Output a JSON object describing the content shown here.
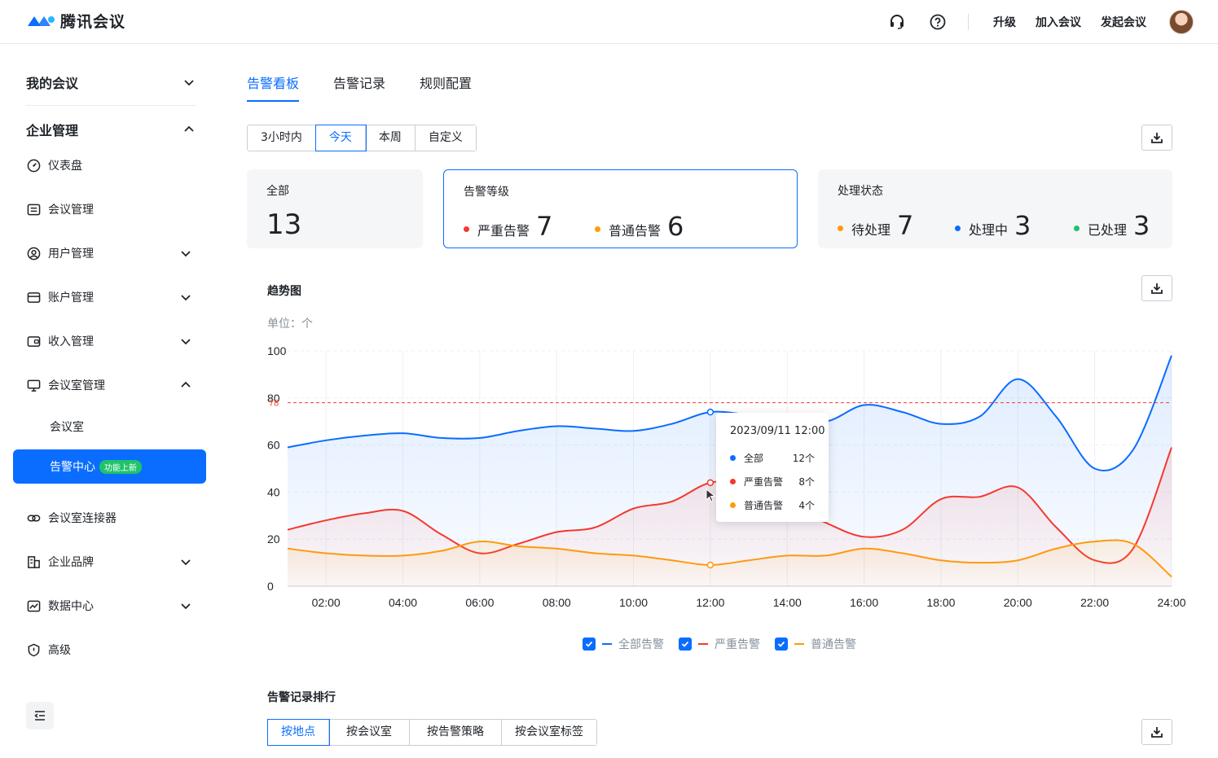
{
  "app": {
    "title": "腾讯会议"
  },
  "header": {
    "upgrade": "升级",
    "join": "加入会议",
    "start": "发起会议"
  },
  "sidebar": {
    "my_meetings": "我的会议",
    "enterprise": "企业管理",
    "items": {
      "dashboard": "仪表盘",
      "meeting_mgmt": "会议管理",
      "user_mgmt": "用户管理",
      "account_mgmt": "账户管理",
      "income_mgmt": "收入管理",
      "room_mgmt": "会议室管理",
      "room": "会议室",
      "alert_center": "告警中心",
      "alert_badge": "功能上新",
      "connector": "会议室连接器",
      "brand": "企业品牌",
      "data_center": "数据中心",
      "advanced": "高级"
    }
  },
  "tabs": [
    "告警看板",
    "告警记录",
    "规则配置"
  ],
  "range_options": [
    "3小时内",
    "今天",
    "本周",
    "自定义"
  ],
  "cards": {
    "all": {
      "title": "全部",
      "value": "13"
    },
    "level": {
      "title": "告警等级",
      "severe_label": "严重告警",
      "severe_value": "7",
      "normal_label": "普通告警",
      "normal_value": "6"
    },
    "status": {
      "title": "处理状态",
      "pending_label": "待处理",
      "pending_value": "7",
      "processing_label": "处理中",
      "processing_value": "3",
      "done_label": "已处理",
      "done_value": "3"
    }
  },
  "trend": {
    "title": "趋势图",
    "unit": "单位：个"
  },
  "tooltip": {
    "time": "2023/09/11 12:00",
    "rows": [
      {
        "label": "全部",
        "value": "12个"
      },
      {
        "label": "严重告警",
        "value": "8个"
      },
      {
        "label": "普通告警",
        "value": "4个"
      }
    ]
  },
  "legend": [
    "全部告警",
    "严重告警",
    "普通告警"
  ],
  "ranking": {
    "title": "告警记录排行",
    "options": [
      "按地点",
      "按会议室",
      "按告警策略",
      "按会议室标签"
    ]
  },
  "colors": {
    "accent": "#0a6dff",
    "severe": "#f5392f",
    "normal": "#ff9a0e",
    "pending": "#ff9a0e",
    "processing": "#0a6dff",
    "done": "#1fc36a"
  },
  "chart_data": {
    "type": "line",
    "x": [
      "01:00",
      "02:00",
      "03:00",
      "04:00",
      "05:00",
      "06:00",
      "07:00",
      "08:00",
      "09:00",
      "10:00",
      "11:00",
      "12:00",
      "13:00",
      "14:00",
      "15:00",
      "16:00",
      "17:00",
      "18:00",
      "19:00",
      "20:00",
      "21:00",
      "22:00",
      "23:00",
      "24:00"
    ],
    "xticks": [
      "02:00",
      "04:00",
      "06:00",
      "08:00",
      "10:00",
      "12:00",
      "14:00",
      "16:00",
      "18:00",
      "20:00",
      "22:00",
      "24:00"
    ],
    "ylim": [
      0,
      100
    ],
    "yticks": [
      "0",
      "20",
      "40",
      "60",
      "80",
      "100"
    ],
    "threshold": 78,
    "threshold_label": "78",
    "series": [
      {
        "name": "全部告警",
        "color": "#0a6dff",
        "values": [
          59,
          62,
          64,
          65,
          63,
          63,
          66,
          68,
          67,
          66,
          69,
          74,
          73,
          73,
          70,
          77,
          74,
          69,
          72,
          88,
          72,
          50,
          58,
          98
        ]
      },
      {
        "name": "严重告警",
        "color": "#f5392f",
        "values": [
          24,
          28,
          31,
          32,
          22,
          14,
          18,
          23,
          25,
          33,
          36,
          44,
          43,
          35,
          27,
          21,
          24,
          37,
          38,
          42,
          25,
          11,
          16,
          59
        ]
      },
      {
        "name": "普通告警",
        "color": "#ff9a0e",
        "values": [
          16,
          14,
          13,
          13,
          15,
          19,
          17,
          16,
          14,
          13,
          11,
          9,
          11,
          13,
          13,
          16,
          14,
          11,
          10,
          11,
          16,
          19,
          18,
          4
        ]
      }
    ]
  }
}
